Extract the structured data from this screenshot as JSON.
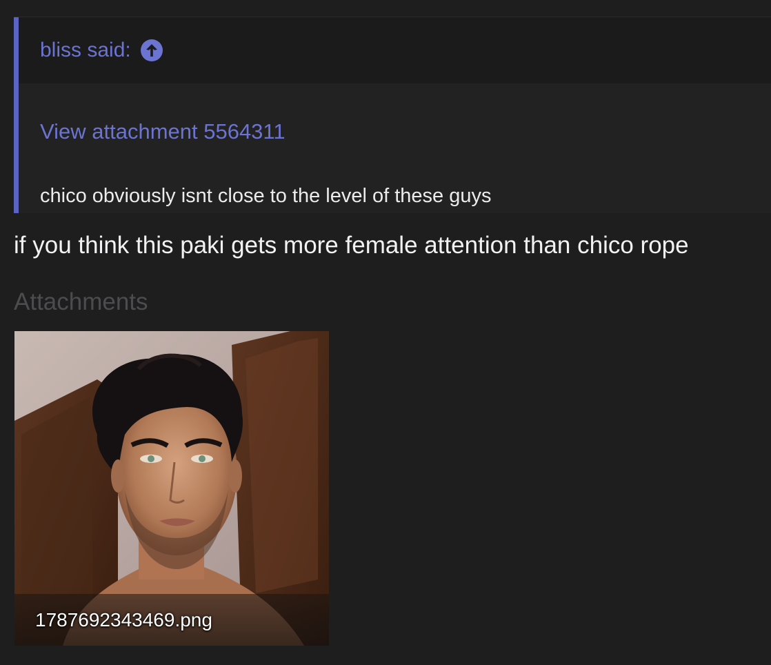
{
  "quote": {
    "author_label": "bliss said:",
    "jump_icon": "arrow-up-circle-icon",
    "attachment_link": "View attachment 5564311",
    "text": "chico obviously isnt close to the level of these guys"
  },
  "post": {
    "text": "if you think this paki gets more female attention than chico rope"
  },
  "attachments": {
    "heading": "Attachments",
    "items": [
      {
        "filename": "1787692343469.png"
      }
    ]
  },
  "colors": {
    "background": "#1e1e1f",
    "quote_accent": "#5b64c2",
    "link": "#6c74d1",
    "text": "#f2f2f2",
    "muted": "#4c4c4e"
  }
}
